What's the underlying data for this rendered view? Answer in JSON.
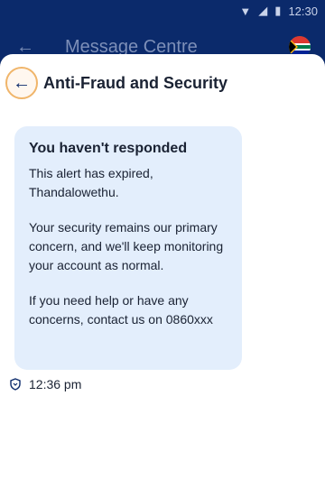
{
  "status": {
    "time": "12:30"
  },
  "app_bar": {
    "title": "Message Centre"
  },
  "sheet": {
    "title": "Anti-Fraud and Security"
  },
  "message": {
    "heading": "You haven't responded",
    "body": [
      "This alert has expired, Thandalowethu.",
      "Your security remains our primary concern, and we'll keep monitoring your account as normal.",
      "If you need help or have any concerns, contact us on 0860xxx"
    ],
    "timestamp": "12:36 pm"
  },
  "colors": {
    "brand": "#0b2a6b",
    "bubble": "#e3eefc",
    "back_circle_border": "#f0b56a"
  }
}
